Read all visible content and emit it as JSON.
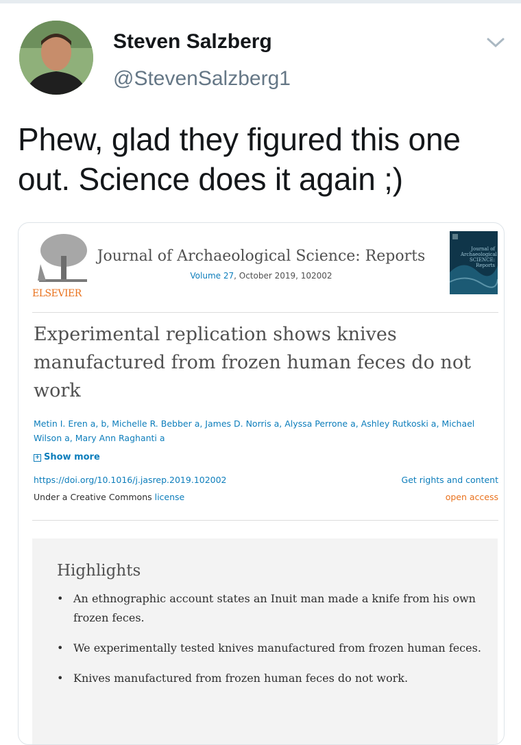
{
  "tweet": {
    "author_name": "Steven Salzberg",
    "handle": "@StevenSalzberg1",
    "text": "Phew, glad they figured this one out. Science does it again ;)"
  },
  "card": {
    "publisher": "ELSEVIER",
    "journal_title": "Journal of Archaeological Science: Reports",
    "volume_link": "Volume 27",
    "volume_rest": ", October 2019, 102002",
    "cover_text": "Journal of Archaeological SCIENCE: Reports",
    "article_title": "Experimental replication shows knives manufactured from frozen human feces do not work",
    "authors": "Metin I. Eren a, b, Michelle R. Bebber a, James D. Norris a, Alyssa Perrone a, Ashley Rutkoski a, Michael Wilson a, Mary Ann Raghanti a",
    "show_more": "Show more",
    "doi": "https://doi.org/10.1016/j.jasrep.2019.102002",
    "rights": "Get rights and content",
    "license_prefix": "Under a Creative Commons ",
    "license_link": "license",
    "open_access": "open access",
    "highlights_heading": "Highlights",
    "highlights": [
      "An ethnographic account states an Inuit man made a knife from his own frozen feces.",
      "We experimentally tested knives manufactured from frozen human feces.",
      "Knives manufactured from frozen human feces do not work."
    ]
  },
  "colors": {
    "link_blue": "#0c7dbb",
    "elsevier_orange": "#e9711c",
    "handle_gray": "#657786"
  }
}
